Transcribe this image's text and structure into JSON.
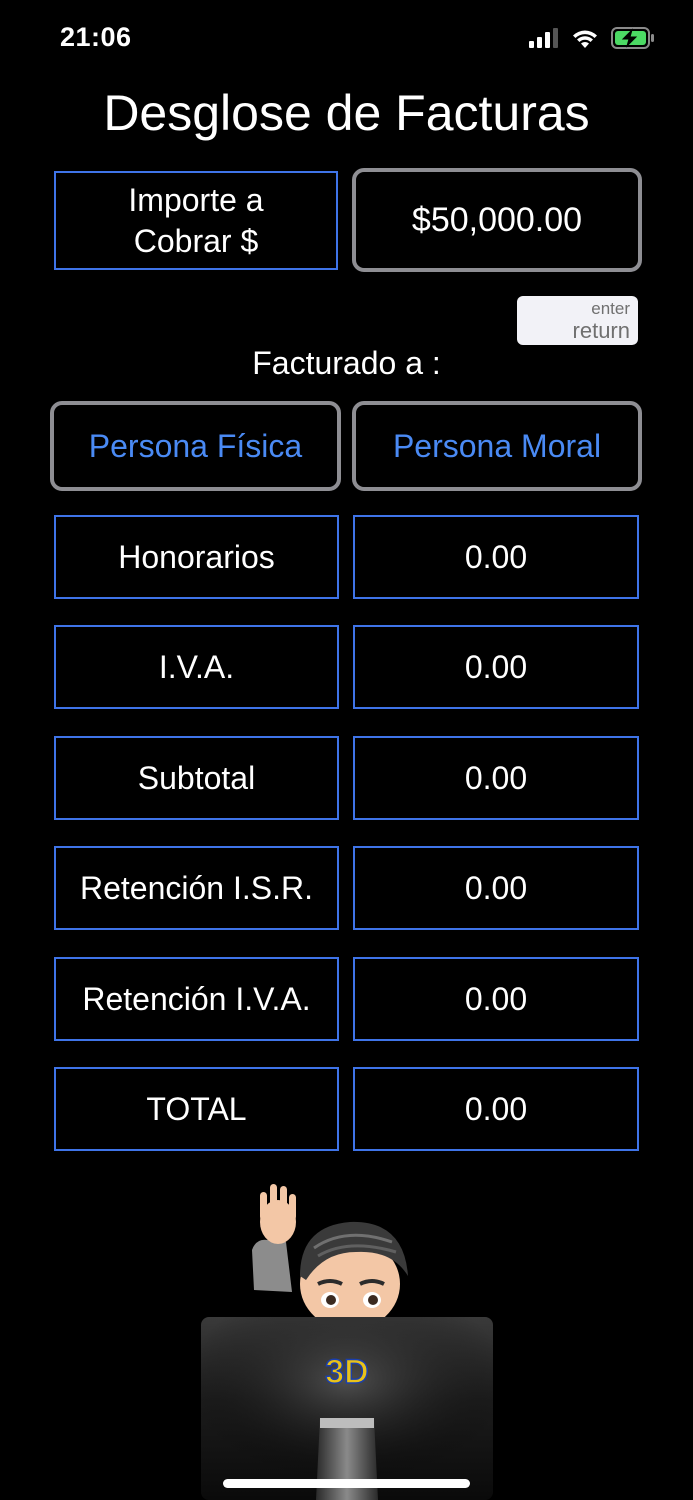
{
  "status_bar": {
    "time": "21:06"
  },
  "title": "Desglose de Facturas",
  "amount": {
    "label": "Importe   a\nCobrar $",
    "value": "$50,000.00"
  },
  "keyboard_key": {
    "line1": "enter",
    "line2": "return"
  },
  "facturado_label": "Facturado a :",
  "buttons": {
    "fisica": "Persona Física",
    "moral": "Persona Moral"
  },
  "rows": [
    {
      "label": "Honorarios",
      "value": "0.00"
    },
    {
      "label": "I.V.A.",
      "value": "0.00"
    },
    {
      "label": "Subtotal",
      "value": "0.00"
    },
    {
      "label": "Retención I.S.R.",
      "value": "0.00"
    },
    {
      "label": "Retención I.V.A.",
      "value": "0.00"
    },
    {
      "label": "TOTAL",
      "value": "0.00"
    }
  ],
  "logo_text": "3D",
  "colors": {
    "background": "#000000",
    "accent_blue": "#3f74e8",
    "button_text_blue": "#4a8af4",
    "button_border_gray": "#8e8e93",
    "battery_green": "#4cd964"
  }
}
